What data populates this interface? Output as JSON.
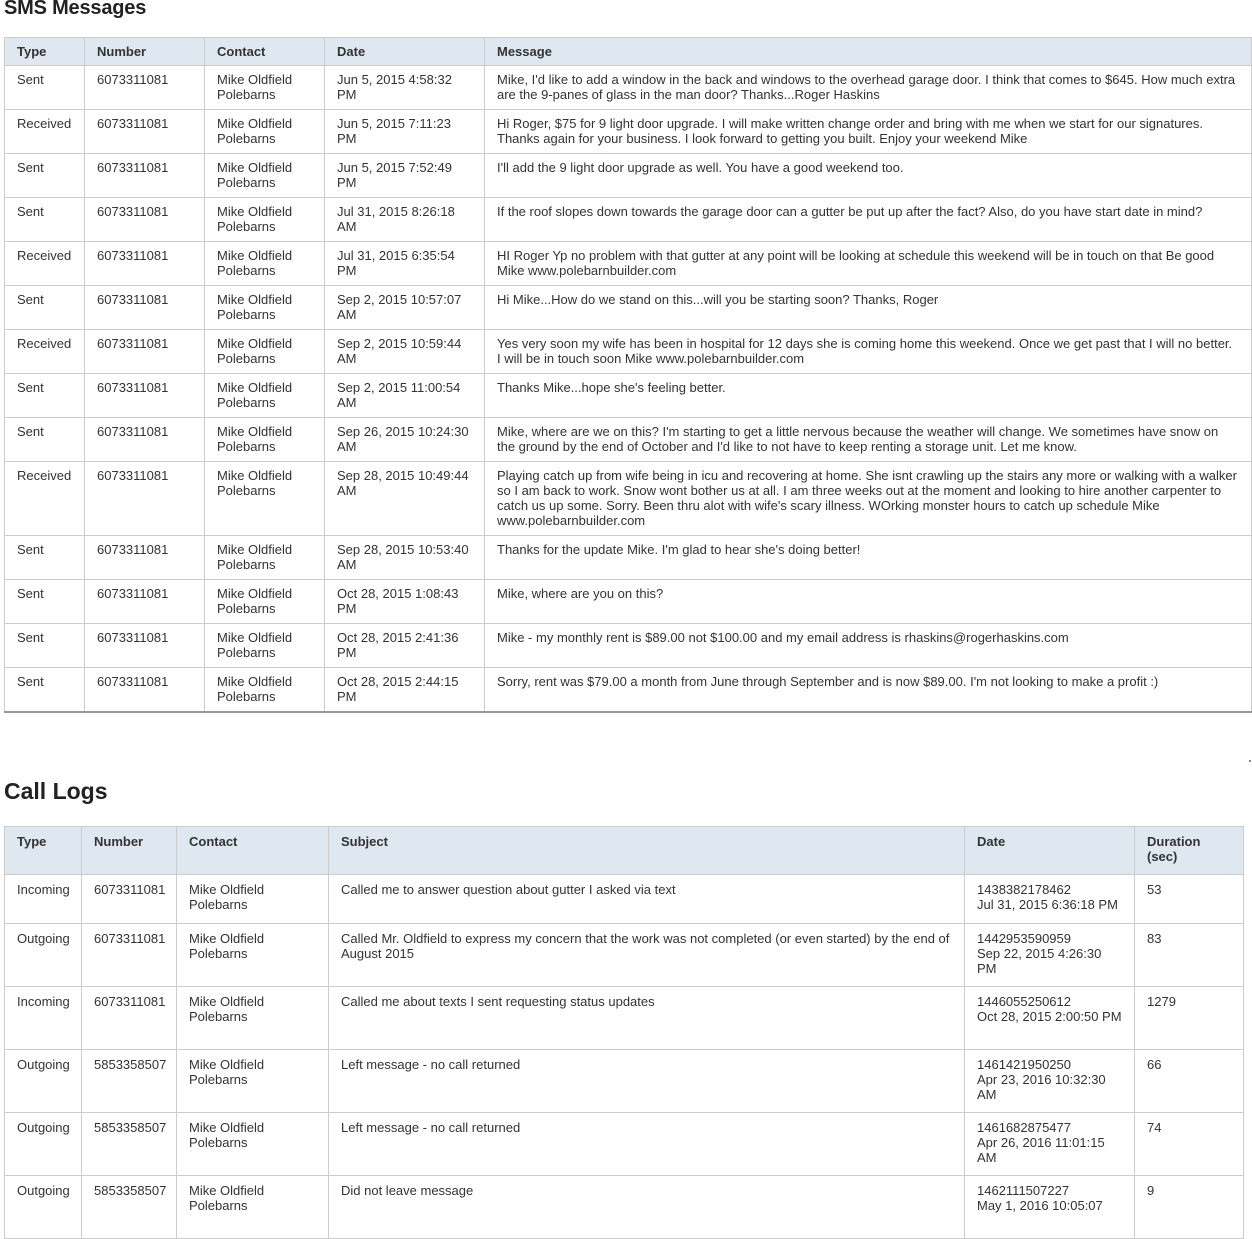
{
  "sms": {
    "title": "SMS Messages",
    "columns": [
      "Type",
      "Number",
      "Contact",
      "Date",
      "Message"
    ],
    "rows": [
      {
        "type": "Sent",
        "number": "6073311081",
        "contact": "Mike Oldfield Polebarns",
        "date": "Jun 5, 2015 4:58:32 PM",
        "message": "Mike, I'd like to add a window in the back and windows to the overhead garage door. I think that comes to $645. How much extra are the 9-panes of glass in the man door? Thanks...Roger Haskins"
      },
      {
        "type": "Received",
        "number": "6073311081",
        "contact": "Mike Oldfield Polebarns",
        "date": "Jun 5, 2015 7:11:23 PM",
        "message": "Hi Roger, $75 for 9 light door upgrade. I will make written change order and bring with me when we start for our signatures. Thanks again for your business. I look forward to getting you built. Enjoy your weekend Mike"
      },
      {
        "type": "Sent",
        "number": "6073311081",
        "contact": "Mike Oldfield Polebarns",
        "date": "Jun 5, 2015 7:52:49 PM",
        "message": "I'll add the 9 light door upgrade as well. You have a good weekend too."
      },
      {
        "type": "Sent",
        "number": "6073311081",
        "contact": "Mike Oldfield Polebarns",
        "date": "Jul 31, 2015 8:26:18 AM",
        "message": "If the roof slopes down towards the garage door can a gutter be put up after the fact? Also, do you have start date in mind?"
      },
      {
        "type": "Received",
        "number": "6073311081",
        "contact": "Mike Oldfield Polebarns",
        "date": "Jul 31, 2015 6:35:54 PM",
        "message": "HI Roger Yp no problem with that gutter at any point will be looking at schedule this weekend will be in touch on that Be good Mike www.polebarnbuilder.com"
      },
      {
        "type": "Sent",
        "number": "6073311081",
        "contact": "Mike Oldfield Polebarns",
        "date": "Sep 2, 2015 10:57:07 AM",
        "message": "Hi Mike...How do we stand on this...will you be starting soon? Thanks, Roger"
      },
      {
        "type": "Received",
        "number": "6073311081",
        "contact": "Mike Oldfield Polebarns",
        "date": "Sep 2, 2015 10:59:44 AM",
        "message": "Yes very soon my wife has been in hospital for 12 days she is coming home this weekend. Once we get past that I will no better. I will be in touch soon Mike www.polebarnbuilder.com"
      },
      {
        "type": "Sent",
        "number": "6073311081",
        "contact": "Mike Oldfield Polebarns",
        "date": "Sep 2, 2015 11:00:54 AM",
        "message": "Thanks Mike...hope she's feeling better."
      },
      {
        "type": "Sent",
        "number": "6073311081",
        "contact": "Mike Oldfield Polebarns",
        "date": "Sep 26, 2015 10:24:30 AM",
        "message": "Mike, where are we on this? I'm starting to get a little nervous because the weather will change. We sometimes have snow on the ground by the end of October and I'd like to not have to keep renting a storage unit. Let me know."
      },
      {
        "type": "Received",
        "number": "6073311081",
        "contact": "Mike Oldfield Polebarns",
        "date": "Sep 28, 2015 10:49:44 AM",
        "message": "Playing catch up from wife being in icu and recovering at home. She isnt crawling up the stairs any more or walking with a walker so I am back to work. Snow wont bother us at all. I am three weeks out at the moment and looking to hire another carpenter to catch us up some. Sorry. Been thru alot with wife's scary illness. WOrking monster hours to catch up schedule Mike www.polebarnbuilder.com"
      },
      {
        "type": "Sent",
        "number": "6073311081",
        "contact": "Mike Oldfield Polebarns",
        "date": "Sep 28, 2015 10:53:40 AM",
        "message": "Thanks for the update Mike. I'm glad to hear she's doing better!"
      },
      {
        "type": "Sent",
        "number": "6073311081",
        "contact": "Mike Oldfield Polebarns",
        "date": "Oct 28, 2015 1:08:43 PM",
        "message": "Mike, where are you on this?"
      },
      {
        "type": "Sent",
        "number": "6073311081",
        "contact": "Mike Oldfield Polebarns",
        "date": "Oct 28, 2015 2:41:36 PM",
        "message": "Mike - my monthly rent is $89.00 not $100.00 and my email address is rhaskins@rogerhaskins.com"
      },
      {
        "type": "Sent",
        "number": "6073311081",
        "contact": "Mike Oldfield Polebarns",
        "date": "Oct 28, 2015 2:44:15 PM",
        "message": "Sorry, rent was $79.00 a month from June through September and is now $89.00. I'm not looking to make a profit :)"
      }
    ]
  },
  "calls": {
    "title": "Call Logs",
    "columns": [
      "Type",
      "Number",
      "Contact",
      "Subject",
      "Date",
      "Duration (sec)"
    ],
    "rows": [
      {
        "type": "Incoming",
        "number": "6073311081",
        "contact": "Mike Oldfield Polebarns",
        "subject": "Called me to answer question about gutter I asked via text",
        "timestamp": "1438382178462",
        "date": "Jul 31, 2015 6:36:18 PM",
        "duration": "53"
      },
      {
        "type": "Outgoing",
        "number": "6073311081",
        "contact": "Mike Oldfield Polebarns",
        "subject": "Called Mr. Oldfield to express my concern that the work was not completed (or even started) by the end of August 2015",
        "timestamp": "1442953590959",
        "date": "Sep 22, 2015 4:26:30 PM",
        "duration": "83"
      },
      {
        "type": "Incoming",
        "number": "6073311081",
        "contact": "Mike Oldfield Polebarns",
        "subject": "Called me about texts I sent requesting status updates",
        "timestamp": "1446055250612",
        "date": "Oct 28, 2015 2:00:50 PM",
        "duration": "1279"
      },
      {
        "type": "Outgoing",
        "number": "5853358507",
        "contact": "Mike Oldfield Polebarns",
        "subject": "Left message - no call returned",
        "timestamp": "1461421950250",
        "date": "Apr 23, 2016 10:32:30 AM",
        "duration": "66"
      },
      {
        "type": "Outgoing",
        "number": "5853358507",
        "contact": "Mike Oldfield Polebarns",
        "subject": "Left message - no call returned",
        "timestamp": "1461682875477",
        "date": "Apr 26, 2016 11:01:15 AM",
        "duration": "74"
      },
      {
        "type": "Outgoing",
        "number": "5853358507",
        "contact": "Mike Oldfield Polebarns",
        "subject": "Did not leave message",
        "timestamp": "1462111507227",
        "date": "May 1, 2016 10:05:07",
        "duration": "9"
      }
    ]
  }
}
